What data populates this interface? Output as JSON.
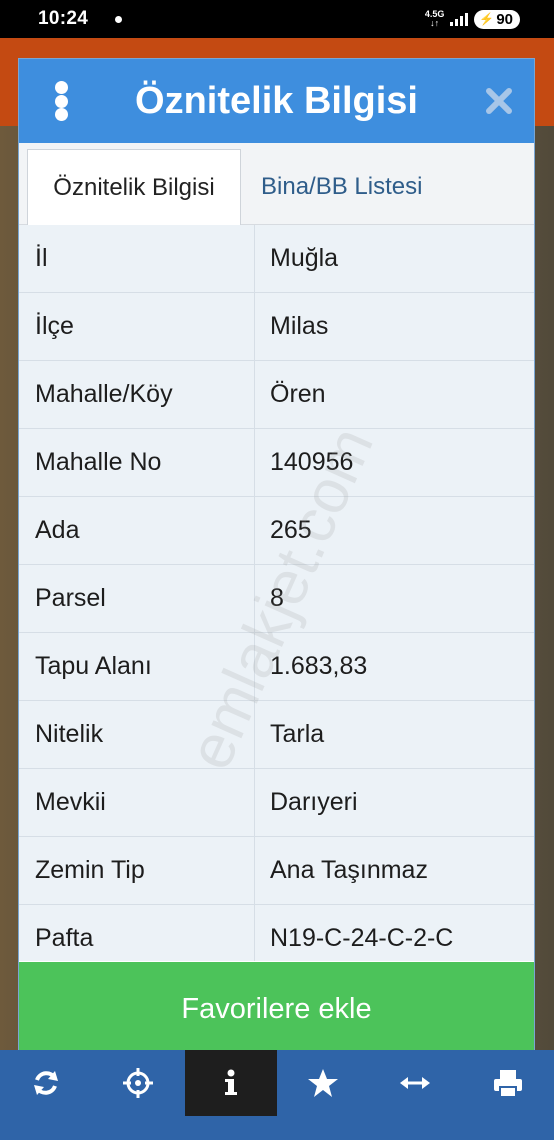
{
  "status_bar": {
    "time": "10:24",
    "network": "4.5G",
    "battery": "90"
  },
  "dialog": {
    "title": "Öznitelik Bilgisi",
    "tabs": [
      {
        "label": "Öznitelik Bilgisi",
        "active": true
      },
      {
        "label": "Bina/BB Listesi",
        "active": false
      }
    ],
    "rows": [
      {
        "key": "İl",
        "value": "Muğla"
      },
      {
        "key": "İlçe",
        "value": "Milas"
      },
      {
        "key": "Mahalle/Köy",
        "value": "Ören"
      },
      {
        "key": "Mahalle No",
        "value": "140956"
      },
      {
        "key": "Ada",
        "value": "265"
      },
      {
        "key": "Parsel",
        "value": "8"
      },
      {
        "key": "Tapu Alanı",
        "value": "1.683,83"
      },
      {
        "key": "Nitelik",
        "value": "Tarla"
      },
      {
        "key": "Mevkii",
        "value": "Darıyeri"
      },
      {
        "key": "Zemin Tip",
        "value": "Ana Taşınmaz"
      },
      {
        "key": "Pafta",
        "value": "N19-C-24-C-2-C"
      }
    ],
    "favorite_button": "Favorilere ekle"
  },
  "watermark": "emlakjet.com",
  "toolbar": {
    "icons": [
      "refresh-icon",
      "crosshair-icon",
      "info-icon",
      "star-icon",
      "resize-horizontal-icon",
      "print-icon"
    ],
    "selected": "info-icon"
  },
  "colors": {
    "header": "#3e8ede",
    "favorite_button": "#4cc35a",
    "toolbar": "#2f64a8",
    "tab_link": "#2f5d8a"
  }
}
